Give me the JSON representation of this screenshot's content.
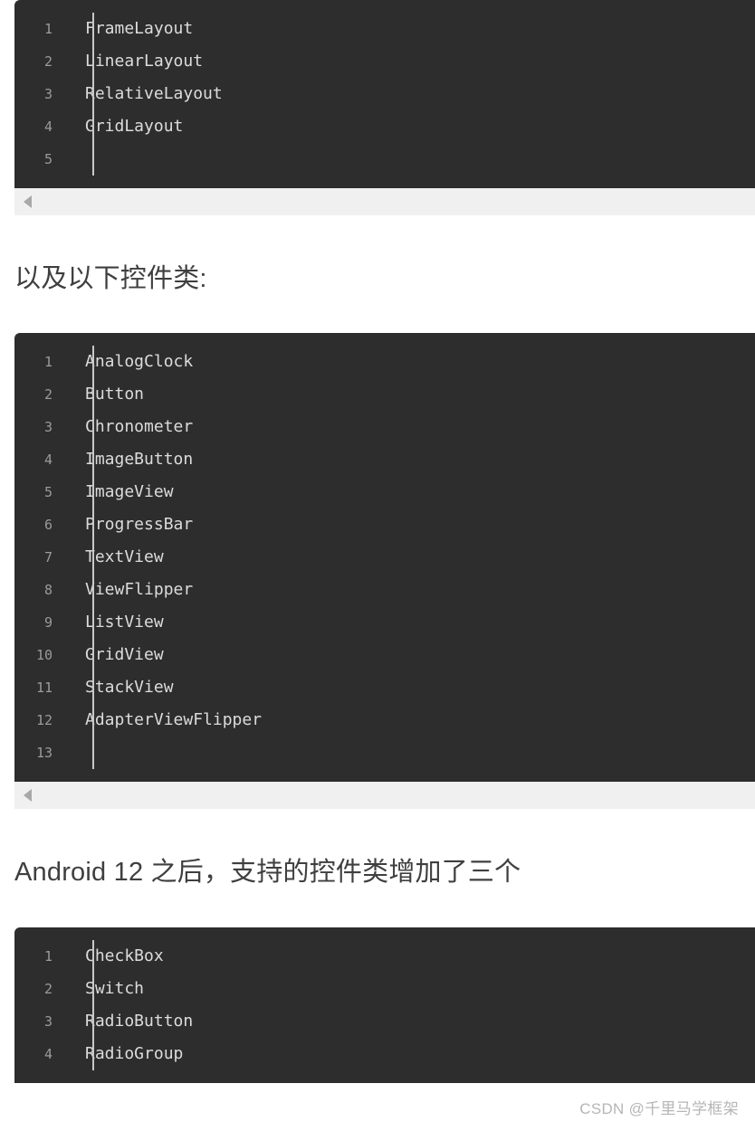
{
  "colors": {
    "page_background": "#ffffff",
    "code_background": "#2d2d2d",
    "code_text": "#dcdcdc",
    "line_number": "#9b9b9b",
    "gutter_rule": "#c9c9c9",
    "scrollbar_track": "#f0f0f0",
    "scrollbar_arrow": "#a8a8a8",
    "heading_text": "#3f3f3f",
    "keyword": "#d16d9e",
    "watermark": "#b6b6b6"
  },
  "blocks": [
    {
      "id": "layout-classes",
      "lines": [
        {
          "no": "1",
          "text": "FrameLayout"
        },
        {
          "no": "2",
          "text": "LinearLayout"
        },
        {
          "no": "3",
          "text": "RelativeLayout"
        },
        {
          "no": "4",
          "text": "GridLayout"
        },
        {
          "no": "5",
          "text": ""
        }
      ]
    },
    {
      "id": "widget-classes",
      "lines": [
        {
          "no": "1",
          "text": "AnalogClock"
        },
        {
          "no": "2",
          "text": "Button"
        },
        {
          "no": "3",
          "text": "Chronometer"
        },
        {
          "no": "4",
          "text": "ImageButton"
        },
        {
          "no": "5",
          "text": "ImageView"
        },
        {
          "no": "6",
          "text": "ProgressBar"
        },
        {
          "no": "7",
          "text": "TextView"
        },
        {
          "no": "8",
          "text": "ViewFlipper"
        },
        {
          "no": "9",
          "text": "ListView"
        },
        {
          "no": "10",
          "text": "GridView"
        },
        {
          "no": "11",
          "text": "StackView"
        },
        {
          "no": "12",
          "text": "AdapterViewFlipper"
        },
        {
          "no": "13",
          "text": ""
        }
      ]
    },
    {
      "id": "android12-classes",
      "lines": [
        {
          "no": "1",
          "text": "CheckBox",
          "keyword": false
        },
        {
          "no": "2",
          "text": "Switch",
          "keyword": true
        },
        {
          "no": "3",
          "text": "RadioButton",
          "keyword": false
        },
        {
          "no": "4",
          "text": "RadioGroup",
          "keyword": false
        }
      ]
    }
  ],
  "headings": {
    "widgets": "以及以下控件类:",
    "android12": "Android 12 之后，支持的控件类增加了三个"
  },
  "scrollbars": {
    "arrow_glyph": "left-triangle",
    "arrow_label": "scroll-left"
  },
  "watermark": {
    "text": "CSDN @千里马学框架"
  }
}
